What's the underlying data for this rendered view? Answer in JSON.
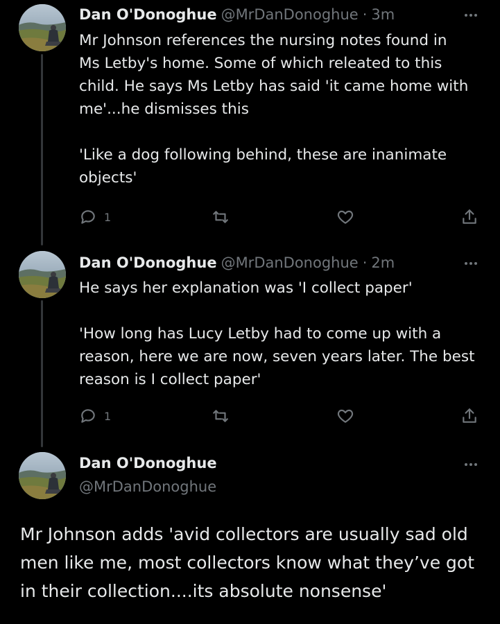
{
  "tweets": [
    {
      "display_name": "Dan O'Donoghue",
      "handle": "@MrDanDonoghue",
      "separator": "·",
      "time": "3m",
      "text": "Mr Johnson references the nursing notes found in\nMs Letby's home. Some of which releated to this\nchild. He says Ms Letby has said 'it came home with\nme'...he dismisses this\n\n'Like a dog following behind, these are inanimate\nobjects'",
      "reply_count": "1"
    },
    {
      "display_name": "Dan O'Donoghue",
      "handle": "@MrDanDonoghue",
      "separator": "·",
      "time": "2m",
      "text": "He says her explanation was 'I collect paper'\n\n'How long has Lucy Letby had to come up with a\nreason, here we are now, seven years later. The best\nreason is I collect paper'",
      "reply_count": "1"
    }
  ],
  "main_tweet": {
    "display_name": "Dan O'Donoghue",
    "handle": "@MrDanDonoghue",
    "text": "Mr Johnson adds 'avid collectors are usually sad old men like me, most collectors know what they’ve got in their collection....its absolute nonsense'"
  },
  "icons": {
    "reply": "reply-bubble-icon",
    "retweet": "retweet-icon",
    "like": "heart-icon",
    "share": "share-upload-icon",
    "more": "more-dots-icon"
  },
  "colors": {
    "background": "#000000",
    "text_primary": "#e7e9ea",
    "text_secondary": "#71767b",
    "thread_line": "#333639"
  }
}
